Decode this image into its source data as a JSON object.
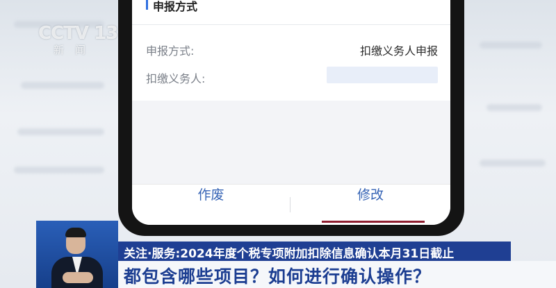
{
  "channel": {
    "logo_main": "CCTV 13",
    "logo_sub": "新闻"
  },
  "form": {
    "section_title": "申报方式",
    "rows": [
      {
        "label": "申报方式:",
        "value": "扣缴义务人申报"
      },
      {
        "label": "扣缴义务人:",
        "value": ""
      }
    ]
  },
  "footer": {
    "void_label": "作废",
    "modify_label": "修改"
  },
  "ticker": {
    "headline": "关注·服务:2024年度个税专项附加扣除信息确认本月31日截止",
    "subtitle": "都包含哪些项目？如何进行确认操作？"
  },
  "colors": {
    "accent": "#2f6fe0",
    "button_text": "#3563b5",
    "active_underline": "#8f1e2f",
    "ticker_bg": "#1f3f93",
    "subtitle_text": "#1b3d91"
  }
}
